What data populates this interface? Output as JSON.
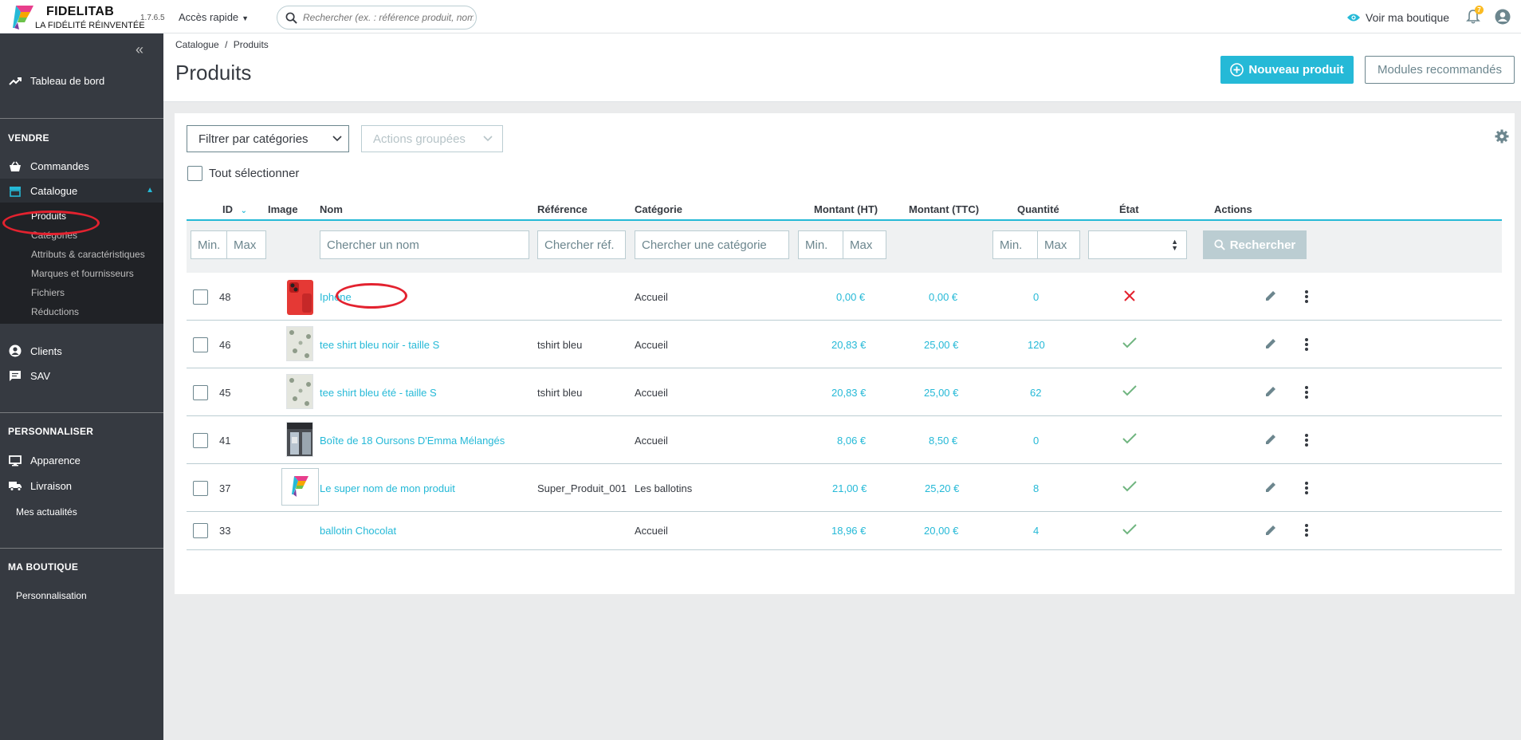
{
  "header": {
    "logo_title": "FIDELITAB",
    "logo_subtitle": "LA FIDÉLITÉ RÉINVENTÉE",
    "version": "1.7.6.5",
    "quick_access": "Accès rapide",
    "search_placeholder": "Rechercher (ex. : référence produit, nom",
    "shop_link": "Voir ma boutique",
    "notification_count": "7"
  },
  "sidebar": {
    "dashboard": "Tableau de bord",
    "section_sell": "VENDRE",
    "orders": "Commandes",
    "catalogue": "Catalogue",
    "catalogue_items": [
      "Produits",
      "Catégories",
      "Attributs & caractéristiques",
      "Marques et fournisseurs",
      "Fichiers",
      "Réductions"
    ],
    "clients": "Clients",
    "sav": "SAV",
    "section_customize": "PERSONNALISER",
    "appearance": "Apparence",
    "shipping": "Livraison",
    "news": "Mes actualités",
    "section_shop": "MA BOUTIQUE",
    "personalization": "Personnalisation"
  },
  "page": {
    "breadcrumb_parent": "Catalogue",
    "breadcrumb_sep": "/",
    "breadcrumb_current": "Produits",
    "title": "Produits",
    "new_product": "Nouveau produit",
    "recommended_modules": "Modules recommandés"
  },
  "toolbar": {
    "filter_categories": "Filtrer par catégories",
    "grouped_actions": "Actions groupées",
    "select_all": "Tout sélectionner"
  },
  "table": {
    "headers": {
      "id": "ID",
      "image": "Image",
      "name": "Nom",
      "reference": "Référence",
      "category": "Catégorie",
      "price_ht": "Montant (HT)",
      "price_ttc": "Montant (TTC)",
      "quantity": "Quantité",
      "status": "État",
      "actions": "Actions"
    },
    "filters": {
      "min": "Min.",
      "max": "Max",
      "name": "Chercher un nom",
      "reference": "Chercher réf.",
      "category": "Chercher une catégorie",
      "search_button": "Rechercher"
    },
    "rows": [
      {
        "id": "48",
        "name": "Iphone",
        "reference": "",
        "category": "Accueil",
        "price_ht": "0,00 €",
        "price_ttc": "0,00 €",
        "quantity": "0",
        "active": false,
        "image": "phone"
      },
      {
        "id": "46",
        "name": "tee shirt bleu noir - taille S",
        "reference": "tshirt bleu",
        "category": "Accueil",
        "price_ht": "20,83 €",
        "price_ttc": "25,00 €",
        "quantity": "120",
        "active": true,
        "image": "shirt"
      },
      {
        "id": "45",
        "name": "tee shirt bleu été - taille S",
        "reference": "tshirt bleu",
        "category": "Accueil",
        "price_ht": "20,83 €",
        "price_ttc": "25,00 €",
        "quantity": "62",
        "active": true,
        "image": "shirt"
      },
      {
        "id": "41",
        "name": "Boîte de 18 Oursons D'Emma Mélangés",
        "reference": "",
        "category": "Accueil",
        "price_ht": "8,06 €",
        "price_ttc": "8,50 €",
        "quantity": "0",
        "active": true,
        "image": "store"
      },
      {
        "id": "37",
        "name": "Le super nom de mon produit",
        "reference": "Super_Produit_001",
        "category": "Les ballotins",
        "price_ht": "21,00 €",
        "price_ttc": "25,20 €",
        "quantity": "8",
        "active": true,
        "image": "logo"
      },
      {
        "id": "33",
        "name": "ballotin Chocolat",
        "reference": "",
        "category": "Accueil",
        "price_ht": "18,96 €",
        "price_ttc": "20,00 €",
        "quantity": "4",
        "active": true,
        "image": "none"
      }
    ]
  },
  "colors": {
    "accent": "#25b9d7",
    "sidebar_bg": "#363a41",
    "success": "#70b580",
    "danger": "#e3222f"
  }
}
